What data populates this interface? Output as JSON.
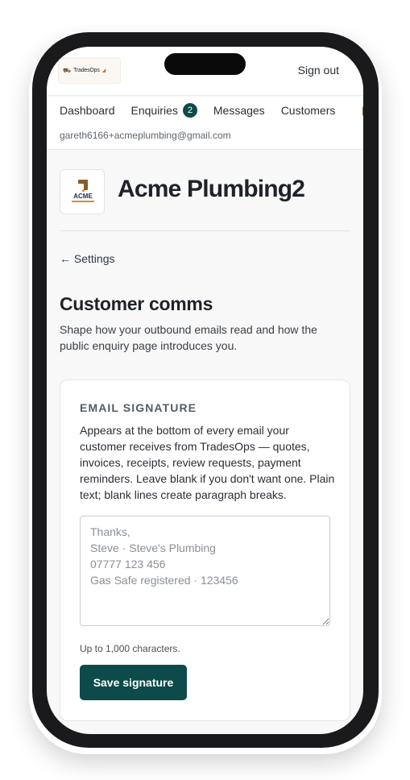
{
  "header": {
    "logo_text": "TradesOps",
    "sign_out_label": "Sign out"
  },
  "nav": {
    "items": [
      {
        "label": "Dashboard"
      },
      {
        "label": "Enquiries",
        "badge": "2"
      },
      {
        "label": "Messages"
      },
      {
        "label": "Customers"
      }
    ],
    "account_email": "gareth6166+acmeplumbing@gmail.com"
  },
  "business": {
    "logo_text": "ACME",
    "name": "Acme Plumbing2"
  },
  "back_link": "← Settings",
  "section": {
    "title": "Customer comms",
    "description": "Shape how your outbound emails read and how the public enquiry page introduces you."
  },
  "signature_card": {
    "label": "EMAIL SIGNATURE",
    "help": "Appears at the bottom of every email your customer receives from TradesOps — quotes, invoices, receipts, review requests, payment reminders. Leave blank if you don't want one. Plain text; blank lines create paragraph breaks.",
    "placeholder": "Thanks,\nSteve · Steve's Plumbing\n07777 123 456\nGas Safe registered · 123456",
    "value": "",
    "limit_note": "Up to 1,000 characters.",
    "save_label": "Save signature"
  },
  "colors": {
    "accent": "#0d4a4a",
    "brand_brown": "#8a5a2b",
    "page_bg": "#f8f8f8",
    "device_frame": "#1a1a1c"
  }
}
